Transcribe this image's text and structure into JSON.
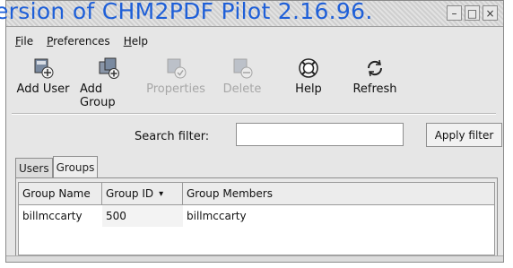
{
  "titlebar": {
    "watermark": "ersion of CHM2PDF Pilot 2.16.96."
  },
  "menubar": [
    {
      "underline": "F",
      "label": "ile"
    },
    {
      "underline": "P",
      "label": "references"
    },
    {
      "underline": "H",
      "label": "elp"
    }
  ],
  "toolbar": [
    {
      "label": "Add User",
      "icon": "add-user-icon",
      "enabled": true
    },
    {
      "label": "Add Group",
      "icon": "add-group-icon",
      "enabled": true
    },
    {
      "label": "Properties",
      "icon": "properties-icon",
      "enabled": false
    },
    {
      "label": "Delete",
      "icon": "delete-icon",
      "enabled": false
    },
    {
      "label": "Help",
      "icon": "help-icon",
      "enabled": true
    },
    {
      "label": "Refresh",
      "icon": "refresh-icon",
      "enabled": true
    }
  ],
  "search": {
    "label": "Search filter:",
    "value": "",
    "apply_label": "Apply filter"
  },
  "tabs": [
    {
      "label": "Users",
      "active": false
    },
    {
      "label": "Groups",
      "active": true
    }
  ],
  "table": {
    "columns": [
      "Group Name",
      "Group ID",
      "Group Members"
    ],
    "sort_indicator": "▾",
    "rows": [
      [
        "billmccarty",
        "500",
        "billmccarty"
      ]
    ]
  },
  "window_controls": {
    "minimize": "–",
    "maximize": "□",
    "close": "×"
  }
}
